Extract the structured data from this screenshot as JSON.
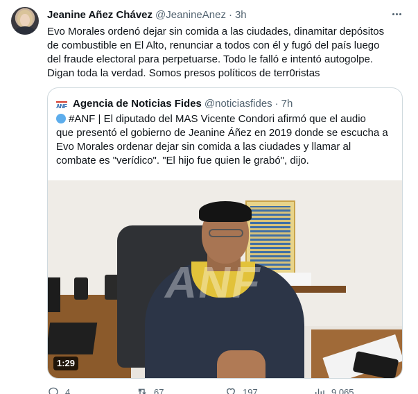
{
  "tweet": {
    "author_name": "Jeanine Añez Chávez",
    "author_handle": "@JeanineAnez",
    "separator": "·",
    "time": "3h",
    "text_lines": [
      "Evo Morales ordenó dejar sin comida a las ciudades,  dinamitar depósitos",
      "de combustible en El Alto, renunciar a todos con él y fugó del país luego",
      "del fraude electoral para perpetuarse. Todo le falló e intentó autogolpe.",
      "Digan toda la verdad. Somos presos políticos de terr0ristas"
    ]
  },
  "quote": {
    "logo_text": "ANF",
    "author_name": "Agencia de Noticias Fides",
    "author_handle": "@noticiasfides",
    "separator": "·",
    "time": "7h",
    "text_lines": [
      "#ANF | El diputado del MAS Vicente Condori afirmó que el audio",
      "que presentó el gobierno de Jeanine Áñez en 2019 donde se escucha a",
      "Evo Morales ordenar dejar sin comida a las ciudades y llamar al",
      "combate es \"verídico\". \"El hijo fue quien le grabó\", dijo."
    ],
    "video": {
      "duration": "1:29",
      "watermark": "ANF"
    }
  },
  "actions": {
    "reply_count": "4",
    "retweet_count": "67",
    "like_count": "197",
    "views_count": "9,065"
  },
  "colors": {
    "secondary_text": "#536471",
    "border": "#cfd9de",
    "blue_circle": "#5dadec"
  }
}
